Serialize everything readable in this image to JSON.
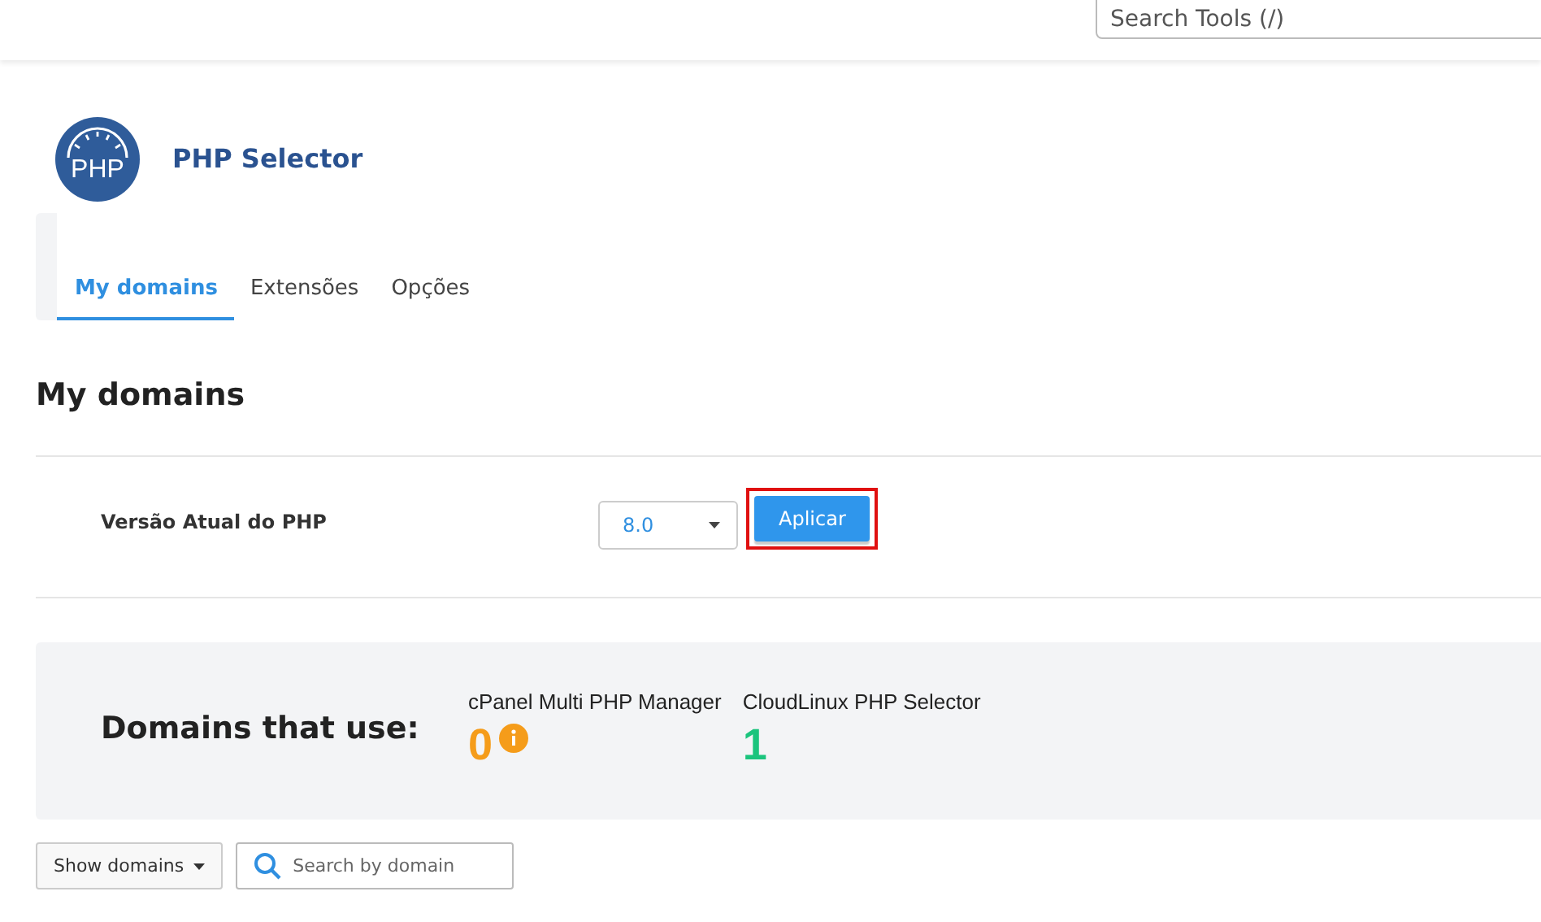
{
  "header": {
    "search": {
      "placeholder": "Search Tools (/)"
    }
  },
  "app": {
    "title": "PHP Selector",
    "logo_text": "PHP"
  },
  "tabs": [
    {
      "label": "My domains",
      "selected": true
    },
    {
      "label": "Extensões",
      "selected": false
    },
    {
      "label": "Opções",
      "selected": false
    }
  ],
  "section_title": "My domains",
  "php_version": {
    "label": "Versão Atual do PHP",
    "value": "8.0",
    "button": {
      "label": "Aplicar",
      "highlighted": true
    }
  },
  "usage": {
    "title": "Domains that use:",
    "counters": [
      {
        "label": "cPanel Multi PHP Manager",
        "count": "0",
        "color": "#f59c1a",
        "info": true
      },
      {
        "label": "CloudLinux PHP Selector",
        "count": "1",
        "color": "#1bc47d",
        "info": false
      }
    ]
  },
  "toolbar": {
    "filter_button": "Show domains",
    "search": {
      "placeholder": "Search by domain"
    }
  }
}
